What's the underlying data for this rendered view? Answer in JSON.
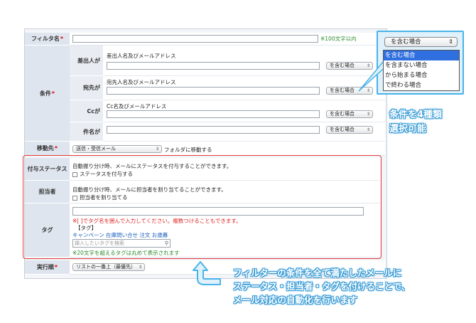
{
  "form": {
    "filter_name": {
      "label": "フィルタ名",
      "req": "*",
      "note": "※100文字以内",
      "value": ""
    },
    "condition": {
      "label": "条件",
      "req": "*",
      "rows": [
        {
          "label": "差出人が",
          "hint": "差出人名及びメールアドレス",
          "value": "",
          "select": "を含む場合"
        },
        {
          "label": "宛先が",
          "hint": "宛先人名及びメールアドレス",
          "value": "",
          "select": "を含む場合"
        },
        {
          "label": "Ccが",
          "hint": "Cc名及びメールアドレス",
          "value": "",
          "select": "を含む場合"
        },
        {
          "label": "件名が",
          "hint": "",
          "value": "",
          "select": "を含む場合"
        }
      ]
    },
    "move_to": {
      "label": "移動先",
      "req": "*",
      "select": "送信・受信メール",
      "suffix": "フォルダに移動する"
    },
    "status": {
      "label": "付与ステータス",
      "desc": "自動振り分け時、メールにステータスを付与することができます。",
      "checkbox": "ステータスを付与する"
    },
    "assignee": {
      "label": "担当者",
      "desc": "自動振り分け時、メールに担当者を割り当てることができます。",
      "checkbox": "担当者を割り当てる"
    },
    "tag": {
      "label": "タグ",
      "note": "※[ ]でタグ名を囲んで入力してください。複数つけることもできます。",
      "example_label": "【タグ】",
      "tags": [
        "キャンペーン",
        "在庫問い合せ",
        "注文",
        "お歳暮"
      ],
      "search_placeholder": "挿入したいタグを検索",
      "limit_note": "※20文字を超えるタグは丸めて表示されます"
    },
    "order": {
      "label": "実行順",
      "req": "*",
      "select": "リストの一番上（最優先）"
    }
  },
  "dropdown": {
    "selected": "を含む場合",
    "options": [
      "を含む場合",
      "を含まない場合",
      "から始まる場合",
      "で終わる場合"
    ]
  },
  "callouts": {
    "condition_note": [
      "条件を4種類",
      "選択可能"
    ],
    "main_note": [
      "フィルターの条件を全て満たしたメールに",
      "ステータス・担当者・タグを付けることで、",
      "メール対応の自動化を行います"
    ]
  },
  "colors": {
    "highlight": "#e23b3b",
    "accent": "#49b3e8",
    "selected_option": "#2f6fe0"
  }
}
